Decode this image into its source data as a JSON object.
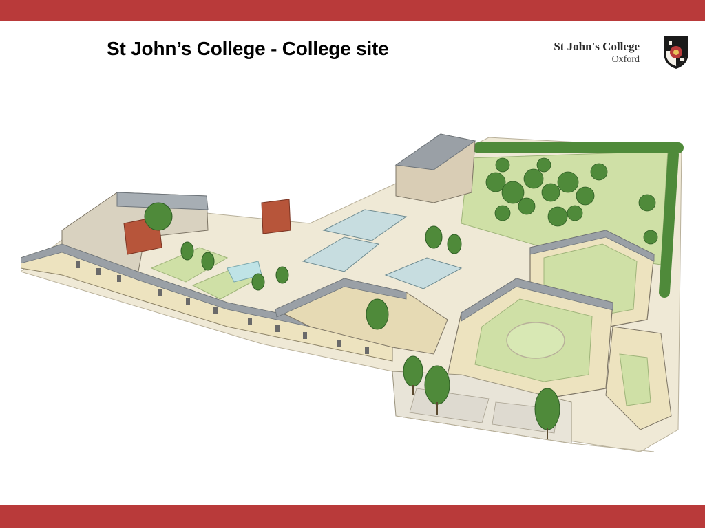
{
  "title": "St John’s College - College site",
  "logo": {
    "name": "St John's College",
    "location": "Oxford",
    "icon": "college-crest-icon"
  },
  "colors": {
    "band": "#b93a3a",
    "stone": "#ede3bf",
    "roof": "#9aa0a6",
    "lawn": "#cfe0a6",
    "tree": "#4f8a3a"
  }
}
